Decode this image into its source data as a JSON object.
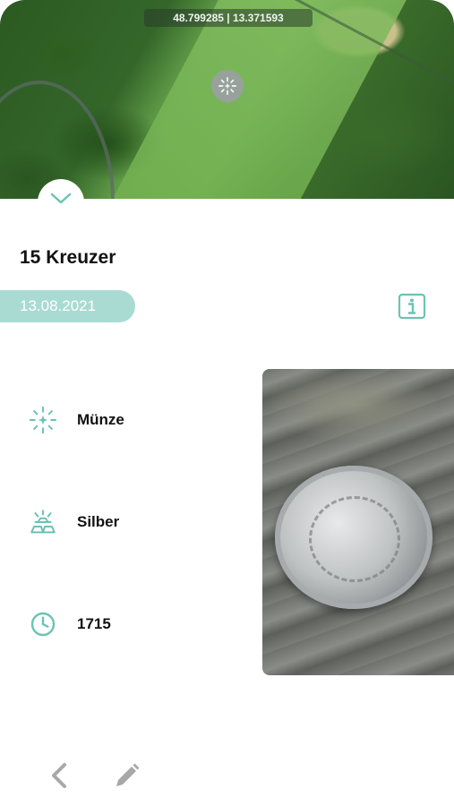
{
  "map": {
    "coordinates": "48.799285 | 13.371593"
  },
  "find": {
    "title": "15 Kreuzer",
    "date": "13.08.2021"
  },
  "attributes": [
    {
      "icon": "sparkle-icon",
      "label": "Münze"
    },
    {
      "icon": "gold-bars-icon",
      "label": "Silber"
    },
    {
      "icon": "clock-icon",
      "label": "1715"
    }
  ],
  "colors": {
    "accent": "#6bc3b3",
    "pill": "#a9dbd2",
    "nav_icon": "#a8a8a8"
  }
}
